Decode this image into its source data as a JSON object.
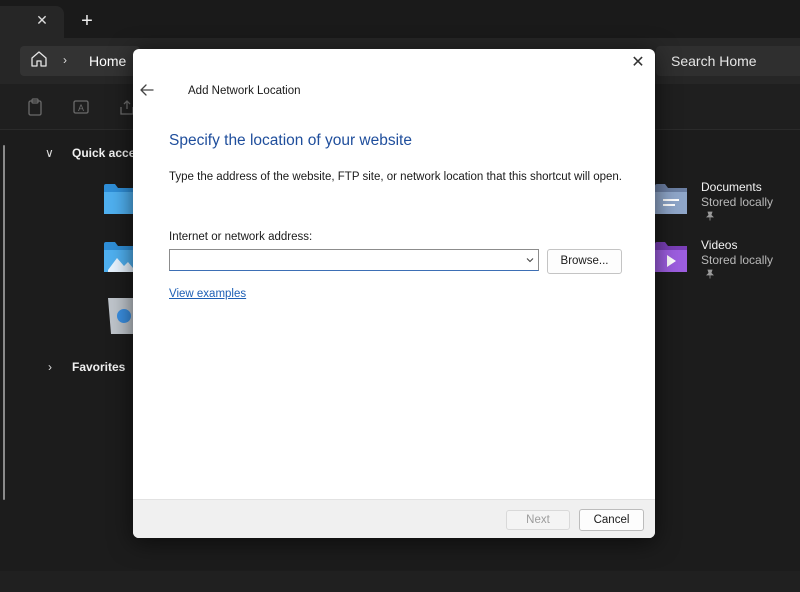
{
  "explorer": {
    "tab_close_glyph": "✕",
    "new_tab_glyph": "+",
    "address": {
      "separator_glyph": "›",
      "location": "Home"
    },
    "search": {
      "placeholder": "Search Home"
    },
    "nav": {
      "items": [
        {
          "label": "Quick acces",
          "chevron": "∨"
        },
        {
          "label": "Favorites",
          "chevron": "›"
        }
      ]
    },
    "quick_access": [
      {
        "title": "Documents",
        "status": "Stored locally",
        "icon": "documents-folder-icon"
      },
      {
        "title": "Videos",
        "status": "Stored locally",
        "icon": "videos-folder-icon"
      }
    ],
    "pin_glyph": "📌"
  },
  "dialog": {
    "close_glyph": "✕",
    "title": "Add Network Location",
    "heading": "Specify the location of your website",
    "description": "Type the address of the website, FTP site, or network location that this shortcut will open.",
    "address_label": "Internet or network address:",
    "address_value": "",
    "browse_label": "Browse...",
    "examples_link": "View examples",
    "next_label": "Next",
    "cancel_label": "Cancel",
    "colors": {
      "heading": "#1f4e9c",
      "link": "#1d5fb5",
      "footer": "#f0f0f0"
    }
  }
}
